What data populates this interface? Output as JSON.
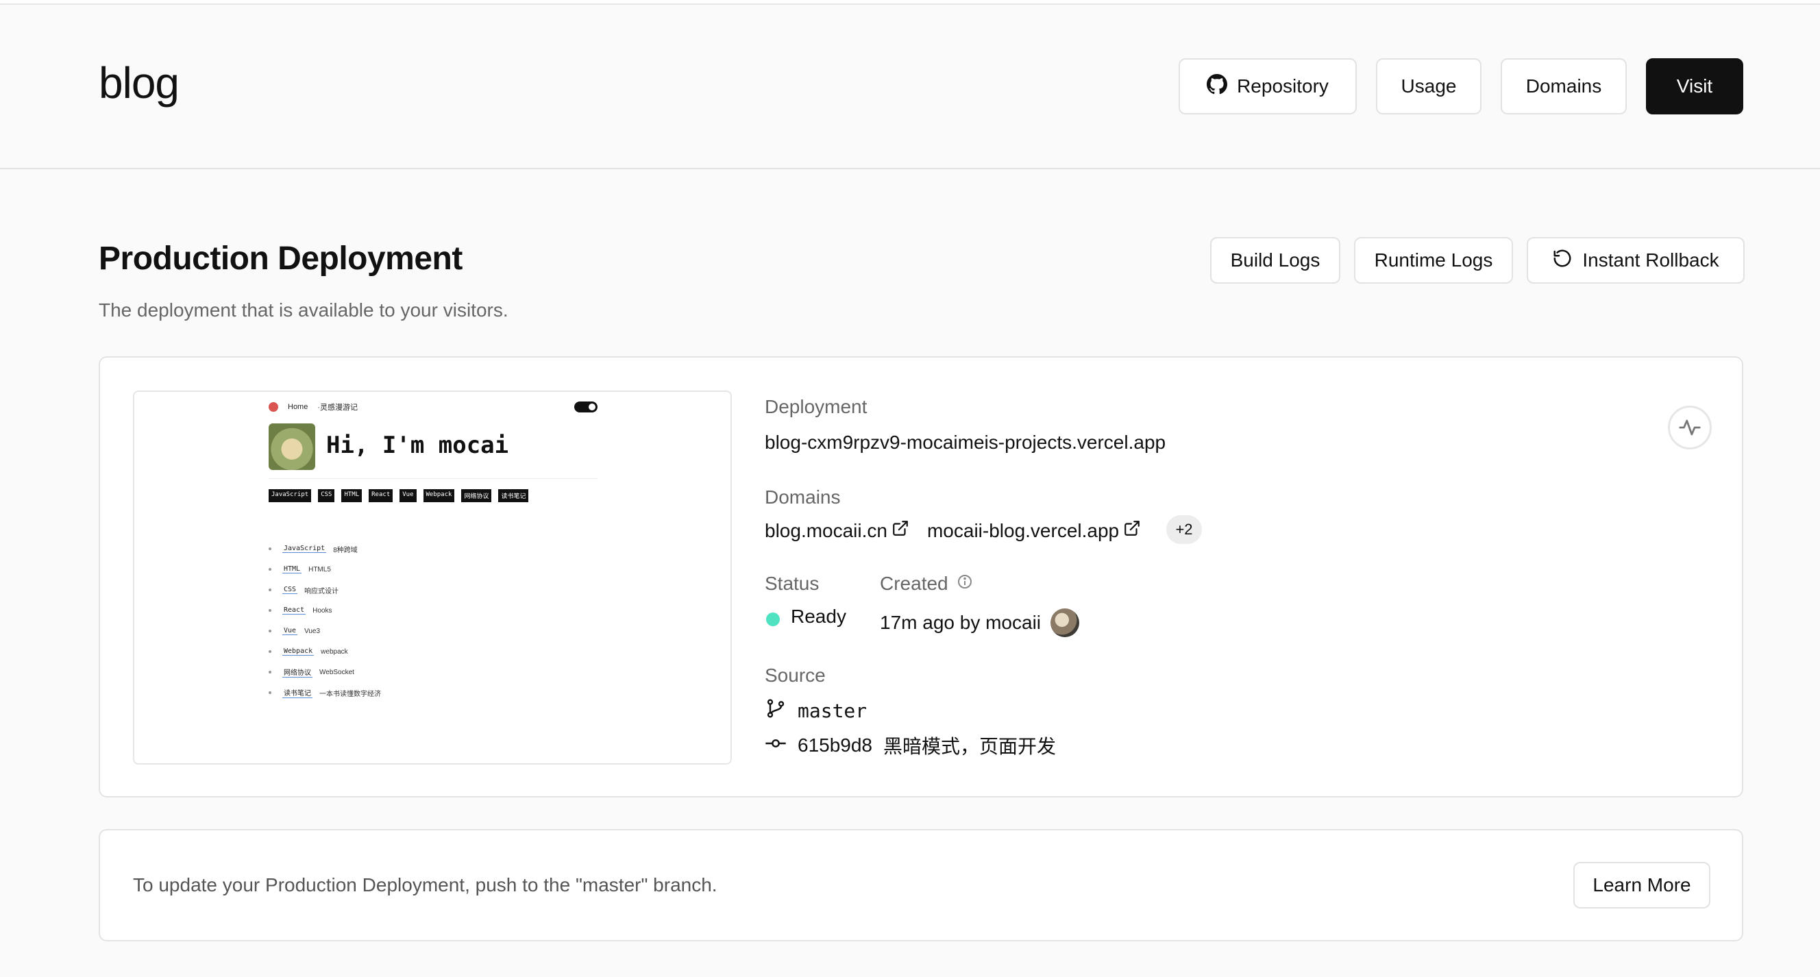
{
  "header": {
    "project_name": "blog",
    "buttons": {
      "repository": "Repository",
      "usage": "Usage",
      "domains": "Domains",
      "visit": "Visit"
    }
  },
  "production": {
    "title": "Production Deployment",
    "subtitle": "The deployment that is available to your visitors.",
    "actions": {
      "build_logs": "Build Logs",
      "runtime_logs": "Runtime Logs",
      "instant_rollback": "Instant Rollback"
    }
  },
  "preview": {
    "nav_home": "Home",
    "nav_title": "·灵感漫游记",
    "greeting": "Hi, I'm mocai",
    "tags": [
      "JavaScript",
      "CSS",
      "HTML",
      "React",
      "Vue",
      "Webpack",
      "网络协议",
      "读书笔记"
    ],
    "list": [
      {
        "key": "JavaScript",
        "desc": "8种跨域"
      },
      {
        "key": "HTML",
        "desc": "HTML5"
      },
      {
        "key": "CSS",
        "desc": "响应式设计"
      },
      {
        "key": "React",
        "desc": "Hooks"
      },
      {
        "key": "Vue",
        "desc": "Vue3"
      },
      {
        "key": "Webpack",
        "desc": "webpack"
      },
      {
        "key": "网络协议",
        "desc": "WebSocket"
      },
      {
        "key": "读书笔记",
        "desc": "一本书读懂数字经济"
      }
    ]
  },
  "deployment": {
    "label": "Deployment",
    "url": "blog-cxm9rpzv9-mocaimeis-projects.vercel.app"
  },
  "domains": {
    "label": "Domains",
    "items": [
      "blog.mocaii.cn",
      "mocaii-blog.vercel.app"
    ],
    "more": "+2"
  },
  "status": {
    "label": "Status",
    "value": "Ready",
    "color": "#50e3c2"
  },
  "created": {
    "label": "Created",
    "value": "17m ago by mocaii"
  },
  "source": {
    "label": "Source",
    "branch": "master",
    "commit_hash": "615b9d8",
    "commit_message": "黑暗模式，页面开发"
  },
  "footer_card": {
    "text": "To update your Production Deployment, push to the \"master\" branch.",
    "learn_more": "Learn More"
  }
}
